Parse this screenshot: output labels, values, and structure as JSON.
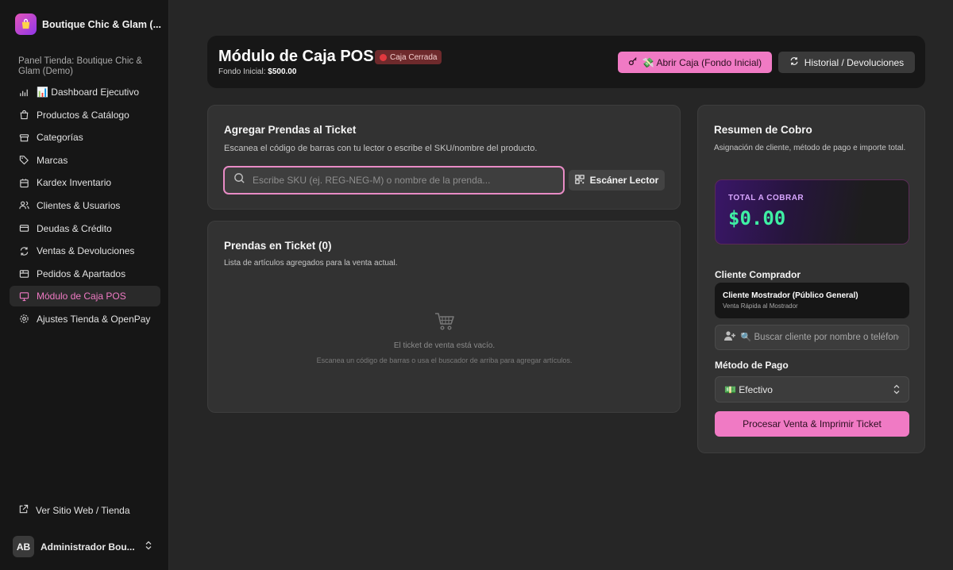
{
  "sidebar": {
    "brand_name": "Boutique Chic & Glam (...",
    "panel_label": "Panel Tienda: Boutique Chic & Glam (Demo)",
    "items": [
      {
        "label": "📊 Dashboard Ejecutivo",
        "icon": "bar-chart-icon"
      },
      {
        "label": "Productos & Catálogo",
        "icon": "shopping-bag-icon"
      },
      {
        "label": "Categorías",
        "icon": "archive-icon"
      },
      {
        "label": "Marcas",
        "icon": "tag-icon"
      },
      {
        "label": "Kardex Inventario",
        "icon": "clipboard-icon"
      },
      {
        "label": "Clientes & Usuarios",
        "icon": "users-icon"
      },
      {
        "label": "Deudas & Crédito",
        "icon": "credit-card-icon"
      },
      {
        "label": "Ventas & Devoluciones",
        "icon": "refresh-icon"
      },
      {
        "label": "Pedidos & Apartados",
        "icon": "package-icon"
      },
      {
        "label": "Módulo de Caja POS",
        "icon": "monitor-icon"
      },
      {
        "label": "Ajustes Tienda & OpenPay",
        "icon": "gear-icon"
      }
    ],
    "active_item": "Módulo de Caja POS",
    "website_link": "Ver Sitio Web / Tienda",
    "user": {
      "initials": "AB",
      "name": "Administrador Bou..."
    }
  },
  "header": {
    "title": "Módulo de Caja POS",
    "status_badge": "Caja Cerrada",
    "fondo_label": "Fondo Inicial:",
    "fondo_value": "$500.00",
    "open_button": "💸 Abrir Caja (Fondo Inicial)",
    "history_button": "Historial / Devoluciones"
  },
  "add_items": {
    "title": "Agregar Prendas al Ticket",
    "subtitle": "Escanea el código de barras con tu lector o escribe el SKU/nombre del producto.",
    "search_placeholder": "Escribe SKU (ej. REG-NEG-M) o nombre de la prenda...",
    "scan_button": "Escáner Lector"
  },
  "ticket": {
    "title": "Prendas en Ticket (0)",
    "subtitle": "Lista de artículos agregados para la venta actual.",
    "empty_text": "El ticket de venta está vacío.",
    "empty_hint": "Escanea un código de barras o usa el buscador de arriba para agregar artículos."
  },
  "summary": {
    "title": "Resumen de Cobro",
    "subtitle": "Asignación de cliente, método de pago e importe total.",
    "total_label": "TOTAL A COBRAR",
    "total_value": "$0.00",
    "client_section": "Cliente Comprador",
    "client_name": "Cliente Mostrador (Público General)",
    "client_sub": "Venta Rápida al Mostrador",
    "client_search_placeholder": "🔍 Buscar cliente por nombre o teléfono",
    "payment_section": "Método de Pago",
    "payment_method": "💵 Efectivo",
    "process_button": "Procesar Venta & Imprimir Ticket"
  },
  "colors": {
    "accent": "#f07ac4",
    "total": "#3ff0a4",
    "danger": "#e0393f"
  }
}
